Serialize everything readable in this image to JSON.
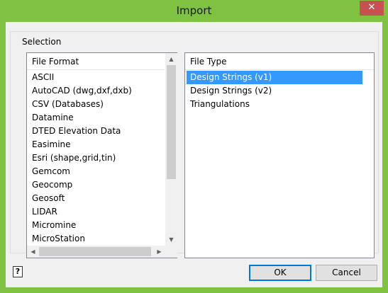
{
  "window": {
    "title": "Import",
    "close_glyph": "✕"
  },
  "selection": {
    "group_label": "Selection",
    "file_format": {
      "header": "File Format",
      "items": [
        "ASCII",
        "AutoCAD (dwg,dxf,dxb)",
        "CSV (Databases)",
        "Datamine",
        "DTED Elevation Data",
        "Easimine",
        "Esri (shape,grid,tin)",
        "Gemcom",
        "Geocomp",
        "Geosoft",
        "LIDAR",
        "Micromine",
        "MicroStation"
      ]
    },
    "file_type": {
      "header": "File Type",
      "items": [
        "Design Strings (v1)",
        "Design Strings (v2)",
        "Triangulations"
      ],
      "selected": "Design Strings (v1)"
    }
  },
  "buttons": {
    "ok": "OK",
    "cancel": "Cancel",
    "help_glyph": "?"
  },
  "scroll_glyphs": {
    "up": "▲",
    "down": "▼",
    "left": "◀",
    "right": "▶"
  },
  "colors": {
    "frame_accent": "#7fc242",
    "close_button": "#c75050",
    "selection_highlight": "#3399ff"
  }
}
